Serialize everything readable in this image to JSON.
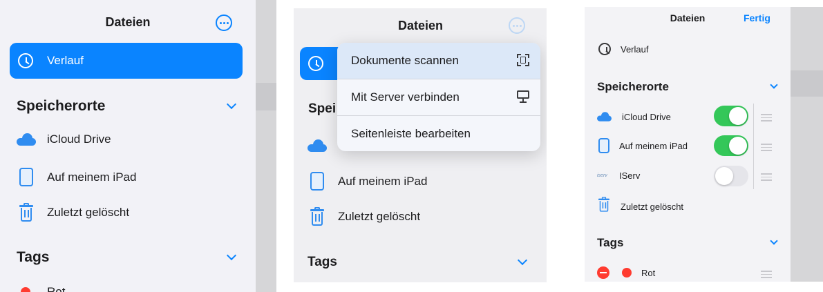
{
  "colors": {
    "accent": "#0a84ff",
    "toggle_on": "#34c759",
    "tag_red": "#ff3b30"
  },
  "panel1": {
    "title": "Dateien",
    "selected_item": {
      "label": "Verlauf",
      "icon": "clock-icon"
    },
    "section_locations": "Speicherorte",
    "locations": [
      {
        "label": "iCloud Drive",
        "icon": "cloud-icon"
      },
      {
        "label": "Auf meinem iPad",
        "icon": "ipad-icon"
      },
      {
        "label": "Zuletzt gelöscht",
        "icon": "trash-icon"
      }
    ],
    "section_tags": "Tags",
    "tags": [
      {
        "label": "Rot",
        "color": "#ff3b30"
      }
    ]
  },
  "panel2": {
    "title": "Dateien",
    "section_locations_partial": "Spei",
    "menu": [
      {
        "label": "Dokumente scannen",
        "icon": "scan-document-icon"
      },
      {
        "label": "Mit Server verbinden",
        "icon": "monitor-icon"
      },
      {
        "label": "Seitenleiste bearbeiten",
        "icon": ""
      }
    ],
    "locations": [
      {
        "label": "Auf meinem iPad",
        "icon": "ipad-icon"
      },
      {
        "label": "Zuletzt gelöscht",
        "icon": "trash-icon"
      }
    ],
    "section_tags": "Tags"
  },
  "panel3": {
    "title": "Dateien",
    "done_label": "Fertig",
    "recents_label": "Verlauf",
    "section_locations": "Speicherorte",
    "locations": [
      {
        "label": "iCloud Drive",
        "icon": "cloud-icon",
        "enabled": true
      },
      {
        "label": "Auf meinem iPad",
        "icon": "ipad-icon",
        "enabled": true
      },
      {
        "label": "IServ",
        "icon": "iserv-logo",
        "logo_text": "iserv",
        "enabled": false
      }
    ],
    "trash_label": "Zuletzt gelöscht",
    "section_tags": "Tags",
    "tags": [
      {
        "label": "Rot",
        "color": "#ff3b30"
      }
    ]
  }
}
